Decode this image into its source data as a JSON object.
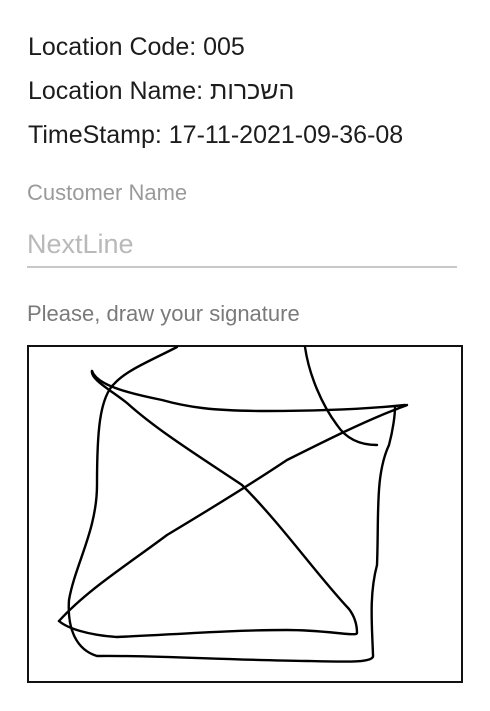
{
  "info": {
    "location_code": "Location Code: 005",
    "location_name": "Location Name: השכרות",
    "timestamp": "TimeStamp: 17-11-2021-09-36-08"
  },
  "customer": {
    "label": "Customer Name",
    "placeholder": "NextLine",
    "value": ""
  },
  "signature": {
    "caption": "Please, draw your signature",
    "stroke_color": "#000000"
  }
}
